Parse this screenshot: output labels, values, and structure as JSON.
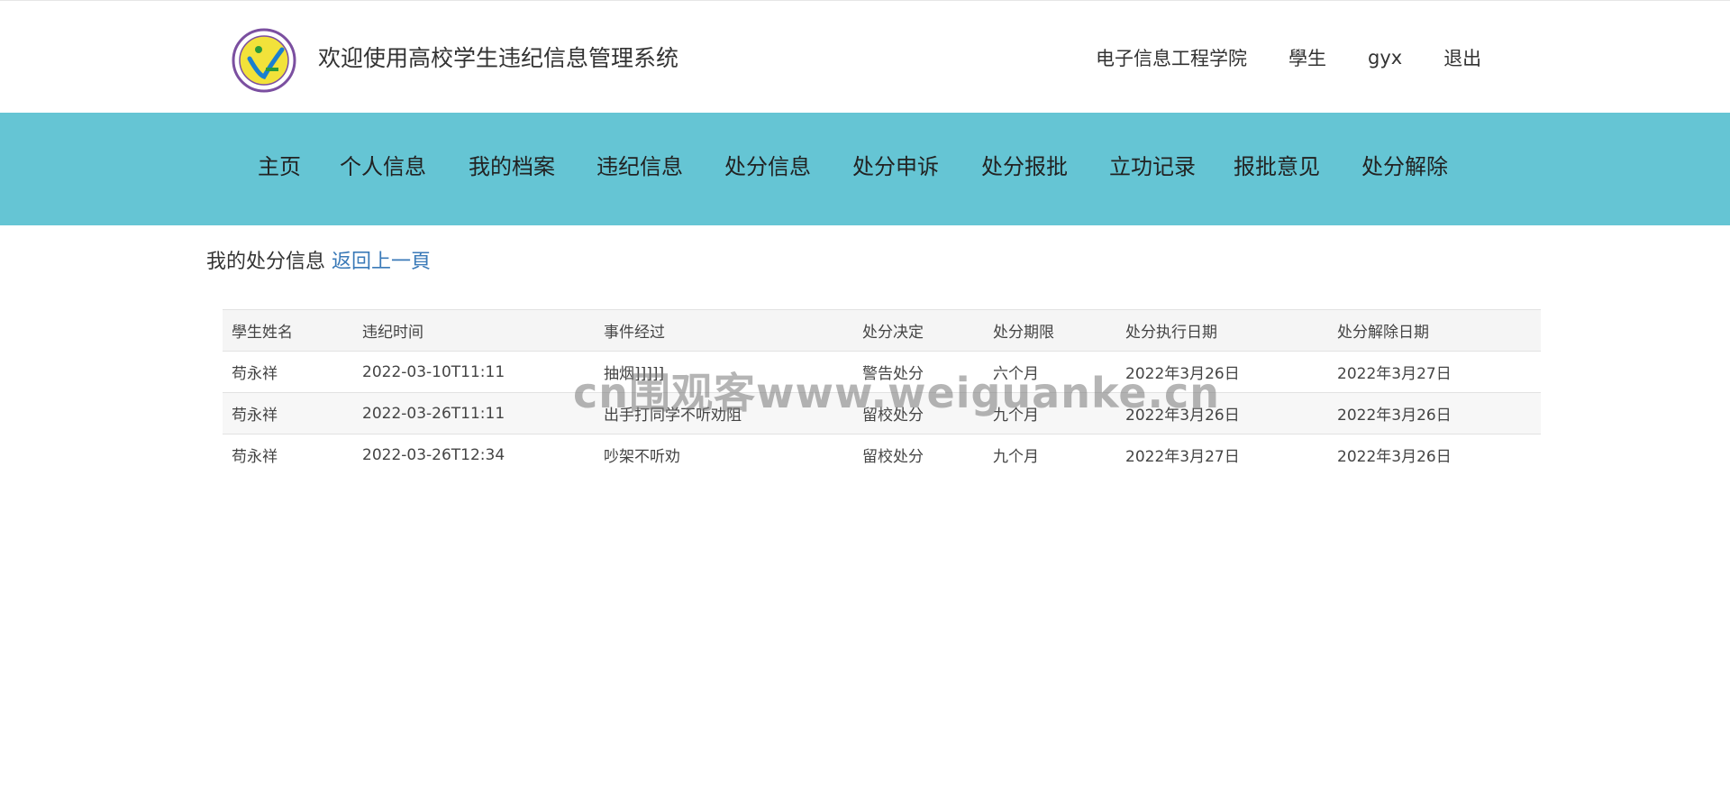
{
  "header": {
    "logo_icon": "school-emblem-icon",
    "title": "欢迎使用高校学生违纪信息管理系统",
    "college": "电子信息工程学院",
    "role": "學生",
    "username": "gyx",
    "logout": "退出"
  },
  "nav": {
    "items": [
      {
        "label": "主页"
      },
      {
        "label": "个人信息"
      },
      {
        "label": "我的档案"
      },
      {
        "label": "违纪信息"
      },
      {
        "label": "处分信息"
      },
      {
        "label": "处分申诉"
      },
      {
        "label": "处分报批"
      },
      {
        "label": "立功记录"
      },
      {
        "label": "报批意见"
      },
      {
        "label": "处分解除"
      }
    ],
    "background": "#65c5d4"
  },
  "main": {
    "heading": "我的处分信息",
    "back_link": "返回上一頁"
  },
  "table": {
    "columns": [
      "學生姓名",
      "违纪时间",
      "事件经过",
      "处分决定",
      "处分期限",
      "处分执行日期",
      "处分解除日期"
    ],
    "rows": [
      [
        "苟永祥",
        "2022-03-10T11:11",
        "抽烟]]]]]",
        "警告处分",
        "六个月",
        "2022年3月26日",
        "2022年3月27日"
      ],
      [
        "苟永祥",
        "2022-03-26T11:11",
        "出手打同学不听劝阻",
        "留校处分",
        "九个月",
        "2022年3月26日",
        "2022年3月26日"
      ],
      [
        "苟永祥",
        "2022-03-26T12:34",
        "吵架不听劝",
        "留校处分",
        "九个月",
        "2022年3月27日",
        "2022年3月26日"
      ]
    ]
  },
  "watermark": "cn围观客www.weiguanke.cn"
}
